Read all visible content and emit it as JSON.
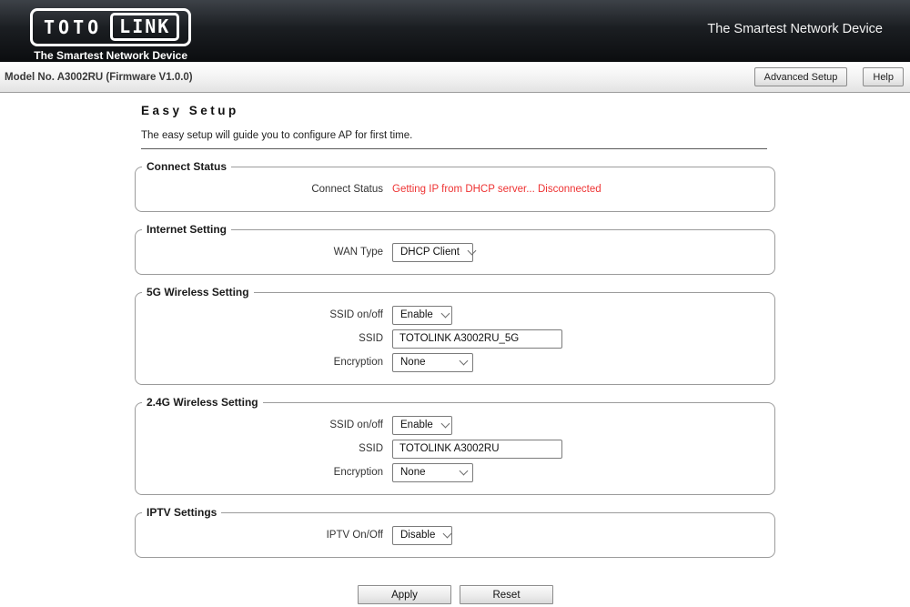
{
  "colors": {
    "status_error_text": "#ee3333",
    "header_background": "#17191c",
    "logo_text": "#ffffff"
  },
  "header": {
    "logo_primary": "TOTO",
    "logo_secondary": "LINK",
    "logo_tagline": "The Smartest Network Device",
    "right_tagline": "The Smartest Network Device"
  },
  "toolbar": {
    "model_label": "Model No. A3002RU (Firmware V1.0.0)",
    "advanced_setup_label": "Advanced Setup",
    "help_label": "Help"
  },
  "page": {
    "title": "Easy Setup",
    "description": "The easy setup will guide you to configure AP for first time."
  },
  "sections": {
    "connect_status": {
      "legend": "Connect Status",
      "row_label": "Connect Status",
      "status_text": "Getting IP from DHCP server... Disconnected"
    },
    "internet_setting": {
      "legend": "Internet Setting",
      "wan_type_label": "WAN Type",
      "wan_type_value": "DHCP Client"
    },
    "wireless_5g": {
      "legend": "5G Wireless Setting",
      "ssid_onoff_label": "SSID on/off",
      "ssid_onoff_value": "Enable",
      "ssid_label": "SSID",
      "ssid_value": "TOTOLINK A3002RU_5G",
      "encryption_label": "Encryption",
      "encryption_value": "None"
    },
    "wireless_24g": {
      "legend": "2.4G Wireless Setting",
      "ssid_onoff_label": "SSID on/off",
      "ssid_onoff_value": "Enable",
      "ssid_label": "SSID",
      "ssid_value": "TOTOLINK A3002RU",
      "encryption_label": "Encryption",
      "encryption_value": "None"
    },
    "iptv": {
      "legend": "IPTV Settings",
      "onoff_label": "IPTV On/Off",
      "onoff_value": "Disable"
    }
  },
  "actions": {
    "apply_label": "Apply",
    "reset_label": "Reset"
  }
}
